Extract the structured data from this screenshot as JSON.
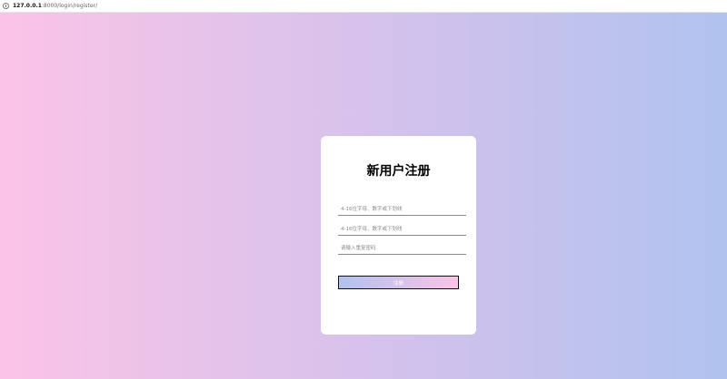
{
  "browser": {
    "url_host": "127.0.0.1",
    "url_path": ":8000/login/register/",
    "icon": "info-icon"
  },
  "colors": {
    "background_left": "#fbc3e7",
    "background_right": "#b1c2ef",
    "card": "#ffffff"
  },
  "form": {
    "title": "新用户注册",
    "username_placeholder": "4-16位字母、数字或下划线",
    "password_placeholder": "4-16位字母、数字或下划线",
    "confirm_placeholder": "请输入重复密码",
    "submit_label": "注册"
  }
}
